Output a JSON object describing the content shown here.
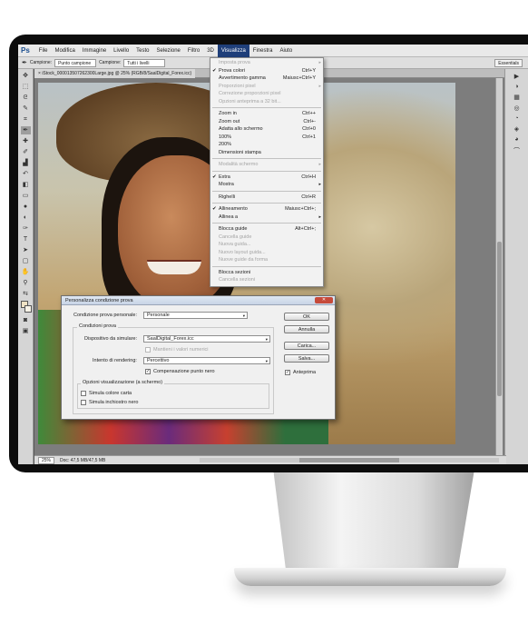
{
  "menubar": {
    "logo": "Ps",
    "items": [
      "File",
      "Modifica",
      "Immagine",
      "Livello",
      "Testo",
      "Selezione",
      "Filtro",
      "3D",
      "Visualizza",
      "Finestra",
      "Aiuto"
    ]
  },
  "optbar": {
    "sample_label": "Campione:",
    "sample_value": "Punto campione",
    "sample2_label": "Campione:",
    "sample2_value": "Tutti i livelli",
    "workspace": "Essentials"
  },
  "document": {
    "tab_title": "iStock_000013507262300Large.jpg @ 25% (RGB/8/SaalDigital_Forex.icc)"
  },
  "statusbar": {
    "zoom": "25%",
    "doc_info": "Doc: 47,5 MB/47,5 MB"
  },
  "view_menu": {
    "items": [
      {
        "label": "Imposta prova",
        "shortcut": "",
        "disabled": true,
        "checked": false,
        "submenu": true
      },
      {
        "label": "Prova colori",
        "shortcut": "Ctrl+Y",
        "disabled": false,
        "checked": true,
        "submenu": false
      },
      {
        "label": "Avvertimento gamma",
        "shortcut": "Maiusc+Ctrl+Y",
        "disabled": false,
        "checked": false,
        "submenu": false
      },
      {
        "label": "Proporzioni pixel",
        "shortcut": "",
        "disabled": true,
        "checked": false,
        "submenu": true
      },
      {
        "label": "Correzione proporzioni pixel",
        "shortcut": "",
        "disabled": true,
        "checked": false,
        "submenu": false
      },
      {
        "label": "Opzioni anteprima a 32 bit...",
        "shortcut": "",
        "disabled": true,
        "checked": false,
        "submenu": false
      },
      {
        "sep": true
      },
      {
        "label": "Zoom in",
        "shortcut": "Ctrl++",
        "disabled": false,
        "checked": false,
        "submenu": false
      },
      {
        "label": "Zoom out",
        "shortcut": "Ctrl+-",
        "disabled": false,
        "checked": false,
        "submenu": false
      },
      {
        "label": "Adatta allo schermo",
        "shortcut": "Ctrl+0",
        "disabled": false,
        "checked": false,
        "submenu": false
      },
      {
        "label": "100%",
        "shortcut": "Ctrl+1",
        "disabled": false,
        "checked": false,
        "submenu": false
      },
      {
        "label": "200%",
        "shortcut": "",
        "disabled": false,
        "checked": false,
        "submenu": false
      },
      {
        "label": "Dimensioni stampa",
        "shortcut": "",
        "disabled": false,
        "checked": false,
        "submenu": false
      },
      {
        "sep": true
      },
      {
        "label": "Modalità schermo",
        "shortcut": "",
        "disabled": true,
        "checked": false,
        "submenu": true
      },
      {
        "sep": true
      },
      {
        "label": "Extra",
        "shortcut": "Ctrl+H",
        "disabled": false,
        "checked": true,
        "submenu": false
      },
      {
        "label": "Mostra",
        "shortcut": "",
        "disabled": false,
        "checked": false,
        "submenu": true
      },
      {
        "sep": true
      },
      {
        "label": "Righelli",
        "shortcut": "Ctrl+R",
        "disabled": false,
        "checked": false,
        "submenu": false
      },
      {
        "sep": true
      },
      {
        "label": "Allineamento",
        "shortcut": "Maiusc+Ctrl+;",
        "disabled": false,
        "checked": true,
        "submenu": false
      },
      {
        "label": "Allinea a",
        "shortcut": "",
        "disabled": false,
        "checked": false,
        "submenu": true
      },
      {
        "sep": true
      },
      {
        "label": "Blocca guide",
        "shortcut": "Alt+Ctrl+;",
        "disabled": false,
        "checked": false,
        "submenu": false
      },
      {
        "label": "Cancella guide",
        "shortcut": "",
        "disabled": true,
        "checked": false,
        "submenu": false
      },
      {
        "label": "Nuova guida...",
        "shortcut": "",
        "disabled": true,
        "checked": false,
        "submenu": false
      },
      {
        "label": "Nuovo layout guida...",
        "shortcut": "",
        "disabled": true,
        "checked": false,
        "submenu": false
      },
      {
        "label": "Nuove guide da forma",
        "shortcut": "",
        "disabled": true,
        "checked": false,
        "submenu": false
      },
      {
        "sep": true
      },
      {
        "label": "Blocca sezioni",
        "shortcut": "",
        "disabled": false,
        "checked": false,
        "submenu": false
      },
      {
        "label": "Cancella sezioni",
        "shortcut": "",
        "disabled": true,
        "checked": false,
        "submenu": false
      }
    ]
  },
  "dialog": {
    "title": "Personalizza condizione prova",
    "condition_label": "Condizione prova personale:",
    "condition_value": "Personale",
    "group_title": "Condizioni prova",
    "device_label": "Dispositivo da simulare:",
    "device_value": "SaalDigital_Forex.icc",
    "keep_values_label": "Mantieni i valori numerici",
    "intent_label": "Intento di rendering:",
    "intent_value": "Percettivo",
    "black_point_label": "Compensazione punto nero",
    "display_group_title": "Opzioni visualizzazione (a schermo)",
    "paper_color_label": "Simula colore carta",
    "black_ink_label": "Simula inchiostro nero",
    "ok_label": "OK",
    "cancel_label": "Annulla",
    "load_label": "Carica...",
    "save_label": "Salva...",
    "preview_label": "Anteprima"
  },
  "icons": {
    "tools": [
      "move-icon",
      "marquee-icon",
      "lasso-icon",
      "quick-select-icon",
      "crop-icon",
      "eyedropper-icon",
      "healing-icon",
      "brush-icon",
      "stamp-icon",
      "history-brush-icon",
      "eraser-icon",
      "gradient-icon",
      "blur-icon",
      "dodge-icon",
      "pen-icon",
      "type-icon",
      "path-select-icon",
      "shape-icon",
      "hand-icon",
      "zoom-icon"
    ]
  }
}
